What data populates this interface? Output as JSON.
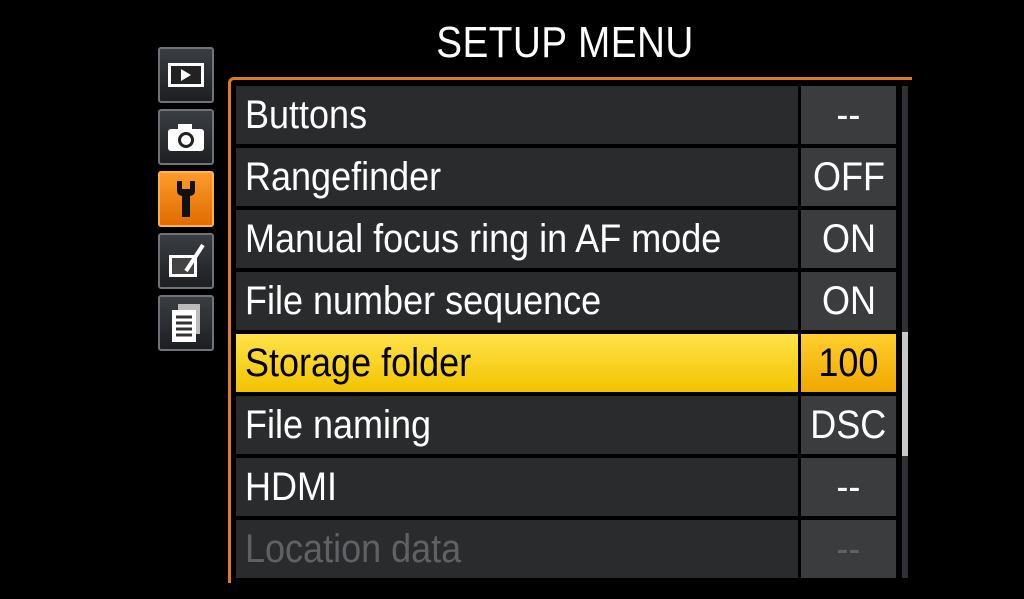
{
  "title": "SETUP MENU",
  "tabs": [
    {
      "icon": "playback-icon"
    },
    {
      "icon": "camera-icon"
    },
    {
      "icon": "wrench-icon"
    },
    {
      "icon": "retouch-icon"
    },
    {
      "icon": "recent-settings-icon"
    }
  ],
  "items": [
    {
      "label": "Buttons",
      "value": "--"
    },
    {
      "label": "Rangefinder",
      "value": "OFF"
    },
    {
      "label": "Manual focus ring in AF mode",
      "value": "ON"
    },
    {
      "label": "File number sequence",
      "value": "ON"
    },
    {
      "label": "Storage folder",
      "value": "100"
    },
    {
      "label": "File naming",
      "value": "DSC"
    },
    {
      "label": "HDMI",
      "value": "--"
    },
    {
      "label": "Location data",
      "value": "--"
    }
  ],
  "selected_index": 4,
  "colors": {
    "accent": "#e07a20",
    "selected": "#f5cc00",
    "active_tab": "#f08a10"
  }
}
